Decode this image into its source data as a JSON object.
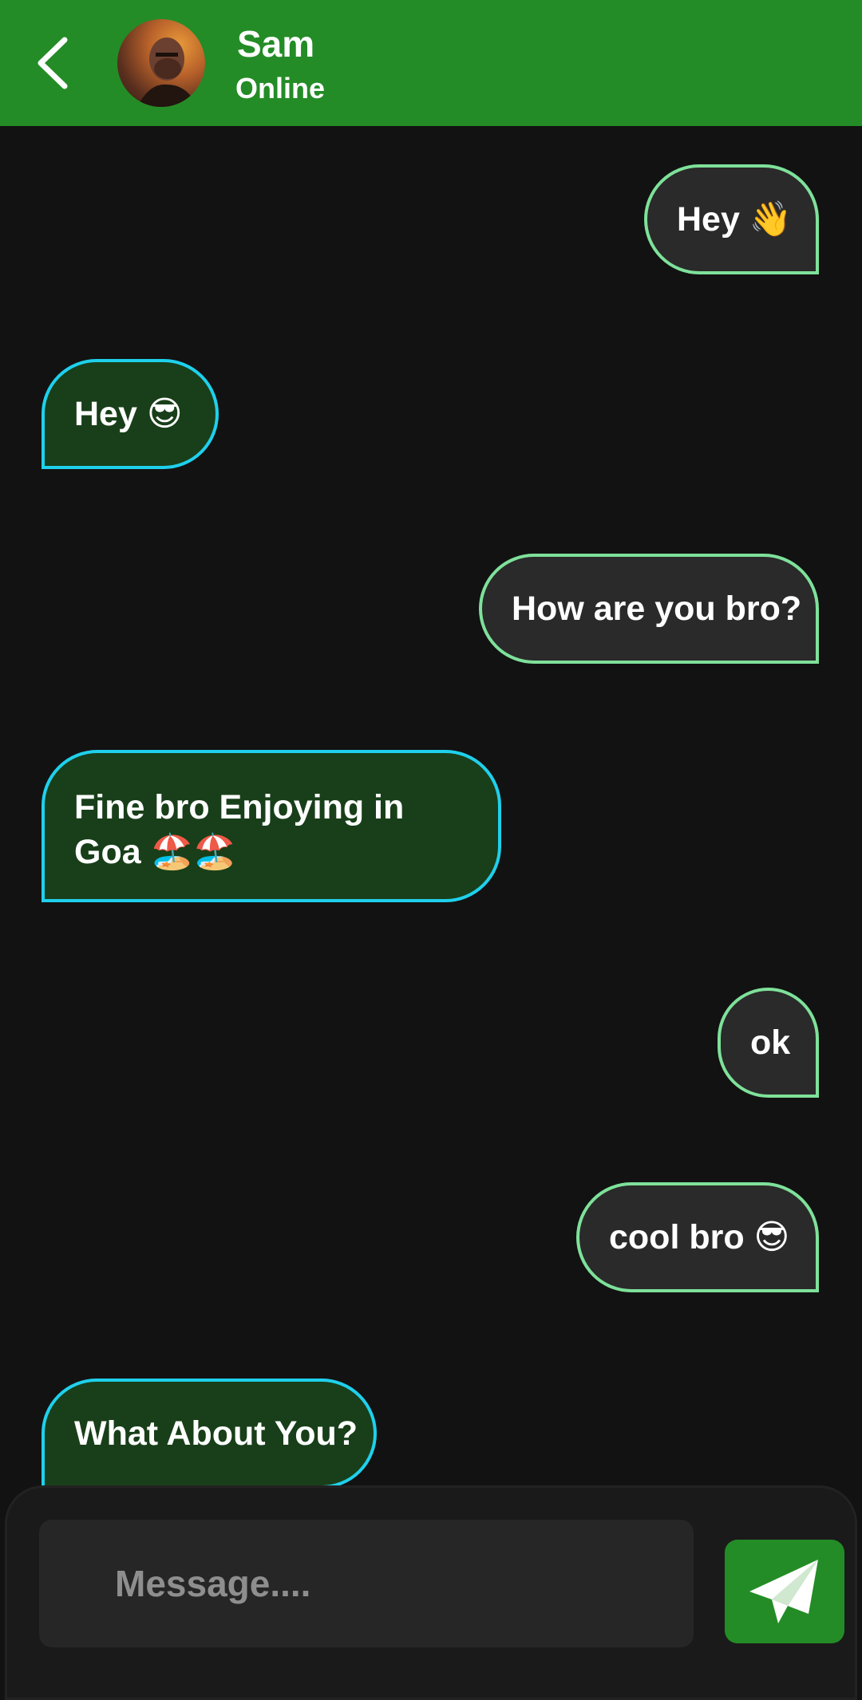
{
  "header": {
    "contact_name": "Sam",
    "status": "Online",
    "back_icon": "chevron-left-icon",
    "background_color": "#238c26"
  },
  "messages": [
    {
      "direction": "sent",
      "text": "Hey 👋"
    },
    {
      "direction": "received",
      "text": "Hey 😎"
    },
    {
      "direction": "sent",
      "text": "How are you bro?"
    },
    {
      "direction": "received",
      "text": "Fine bro Enjoying in Goa 🏖️🏖️"
    },
    {
      "direction": "sent",
      "text": "ok"
    },
    {
      "direction": "sent",
      "text": "cool bro 😎"
    },
    {
      "direction": "received",
      "text": "What About You?"
    }
  ],
  "composer": {
    "placeholder": "Message....",
    "value": "",
    "send_icon": "paper-plane-icon"
  },
  "colors": {
    "background": "#121212",
    "sent_border": "#7ee19a",
    "sent_fill": "#2a2a2a",
    "received_border": "#1fd0ec",
    "received_fill": "#183f19",
    "accent": "#238c26"
  }
}
